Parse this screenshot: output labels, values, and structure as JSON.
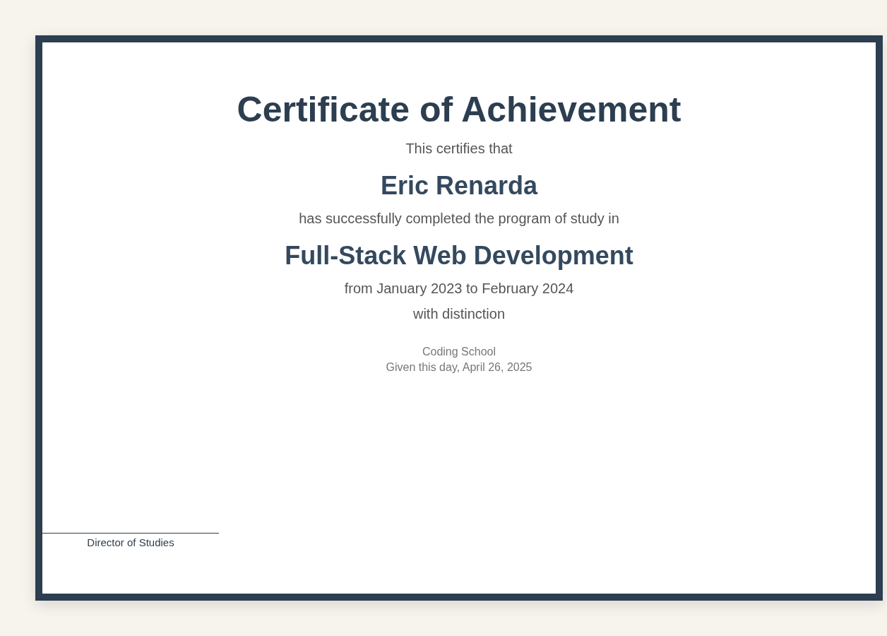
{
  "certificate": {
    "title": "Certificate of Achievement",
    "intro": "This certifies that",
    "recipient": "Eric Renarda",
    "completion_text": "has successfully completed the program of study in",
    "program": "Full-Stack Web Development",
    "period": "from January 2023 to February 2024",
    "honor": "with distinction",
    "school": "Coding School",
    "date_line": "Given this day, April 26, 2025",
    "signature_label": "Director of Studies"
  }
}
